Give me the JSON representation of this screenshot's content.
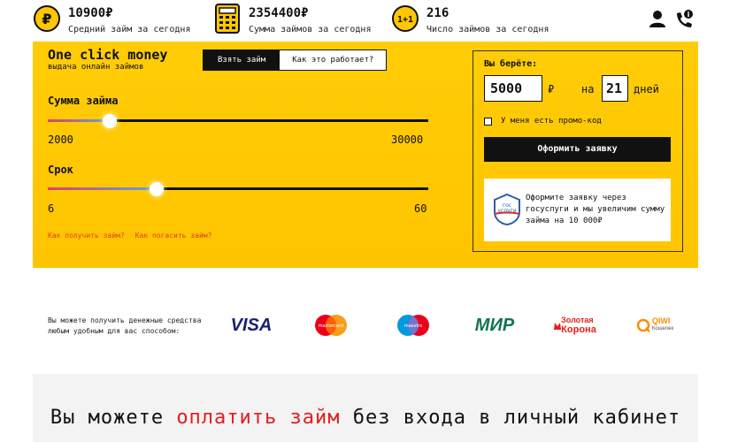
{
  "stats": [
    {
      "value": "10900₽",
      "caption": "Средний займ за сегодня",
      "icon": "ruble-coin-icon"
    },
    {
      "value": "2354400₽",
      "caption": "Сумма займов за сегодня",
      "icon": "calculator-icon"
    },
    {
      "value": "216",
      "caption": "Число займов за сегодня",
      "icon": "one-plus-one-icon"
    }
  ],
  "header_icons": [
    "user-icon",
    "phone-info-icon"
  ],
  "brand": {
    "name": "One click money",
    "tagline": "выдача онлайн займов"
  },
  "tabs": [
    {
      "label": "Взять займ",
      "active": true
    },
    {
      "label": "Как это работает?",
      "active": false
    }
  ],
  "sum_slider": {
    "label": "Сумма займа",
    "min": "2000",
    "max": "30000",
    "value": 5000
  },
  "term_slider": {
    "label": "Срок",
    "min": "6",
    "max": "60",
    "value": 21
  },
  "links": {
    "how_get": "Как получить займ?",
    "how_repay": "Как погасить займ?"
  },
  "order": {
    "title": "Вы берёте:",
    "amount": "5000",
    "currency": "₽",
    "on": "на",
    "days_value": "21",
    "days_unit": "дней",
    "promo_label": "У меня есть промо-код",
    "apply_label": "Оформить заявку"
  },
  "gosuslugi": {
    "logo_line1": "гос",
    "logo_line2": "услуги",
    "text": "Оформите заявку через госуслуги и мы увеличим сумму займа на 10 000₽"
  },
  "payments": {
    "text_line1": "Вы можете получить денежные средства",
    "text_line2": "любым удобным для вас способом:",
    "methods": [
      {
        "name": "VISA"
      },
      {
        "name": "mastercard"
      },
      {
        "name": "maestro"
      },
      {
        "name": "МИР"
      },
      {
        "name_line1": "Золотая",
        "name_line2": "Корона"
      },
      {
        "name": "QIWI",
        "sub": "Кошелек"
      }
    ]
  },
  "banner": {
    "part1": "Вы можете ",
    "part2": "оплатить займ",
    "part3": " без входа в личный кабинет"
  },
  "colors": {
    "accent_yellow": "#ffc700",
    "link_red": "#e23b1c",
    "banner_red": "#e31d1d"
  }
}
